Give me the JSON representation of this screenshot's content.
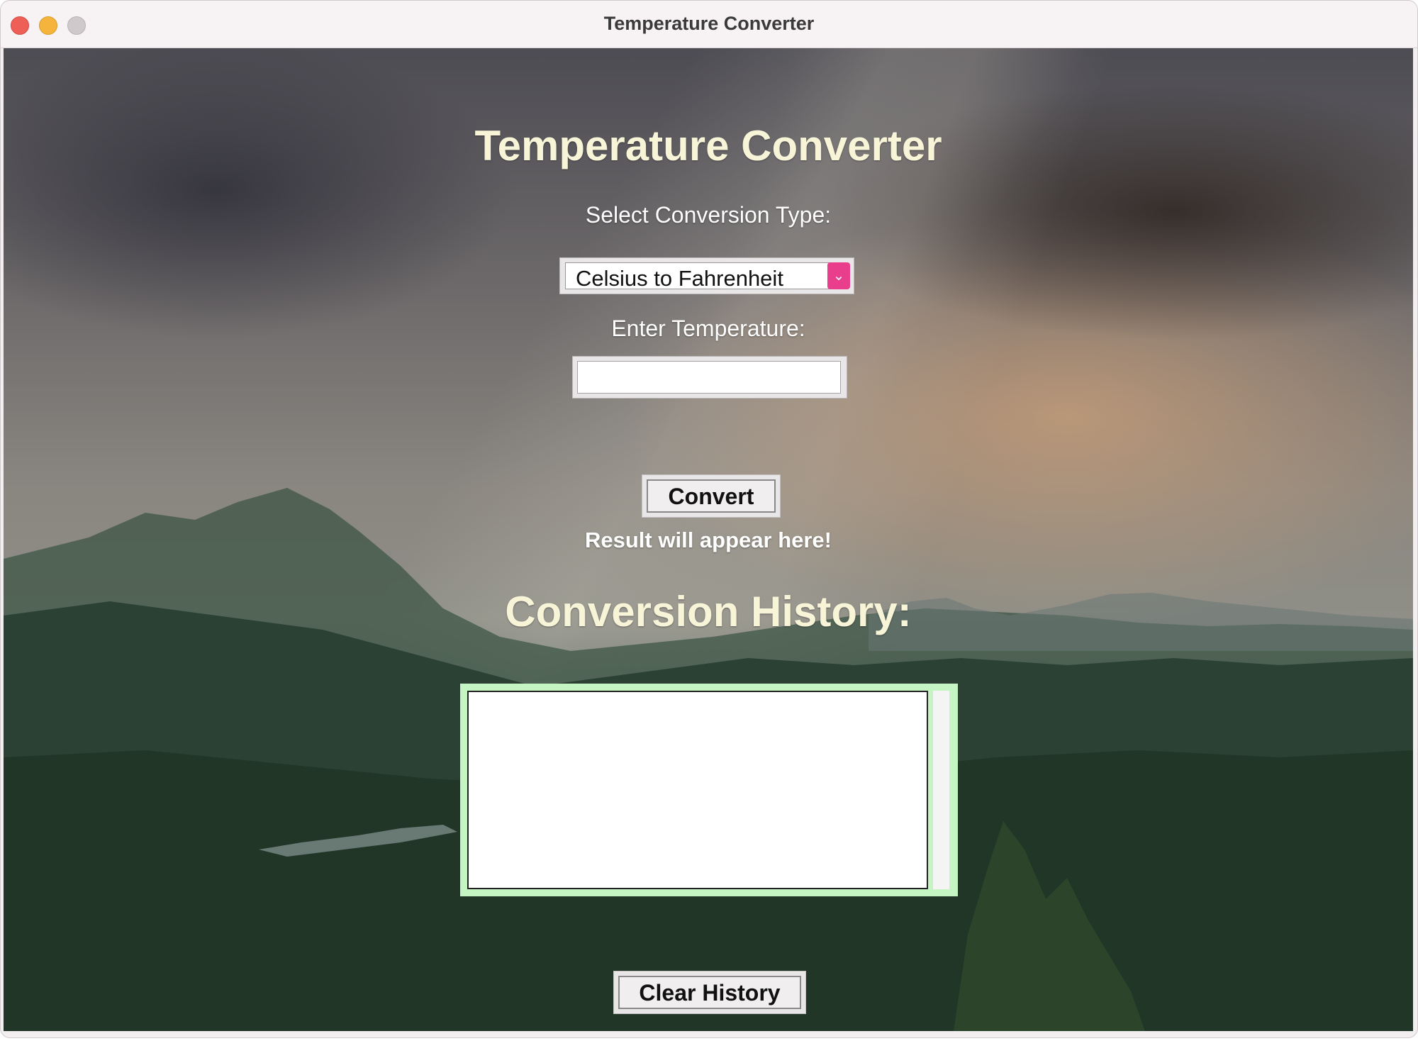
{
  "window": {
    "title": "Temperature Converter"
  },
  "app": {
    "heading": "Temperature Converter",
    "conversion_label": "Select Conversion Type:",
    "conversion_selected": "Celsius to Fahrenheit",
    "temperature_label": "Enter Temperature:",
    "temperature_value": "",
    "convert_label": "Convert",
    "result_text": "Result will appear here!",
    "history_heading": "Conversion History:",
    "history_items": [],
    "clear_label": "Clear History"
  },
  "colors": {
    "heading": "#f7f4d8",
    "dropdown_arrow": "#e83e8c",
    "history_border": "#c6f5c4"
  },
  "icons": {
    "dropdown": "chevron-down-icon"
  }
}
